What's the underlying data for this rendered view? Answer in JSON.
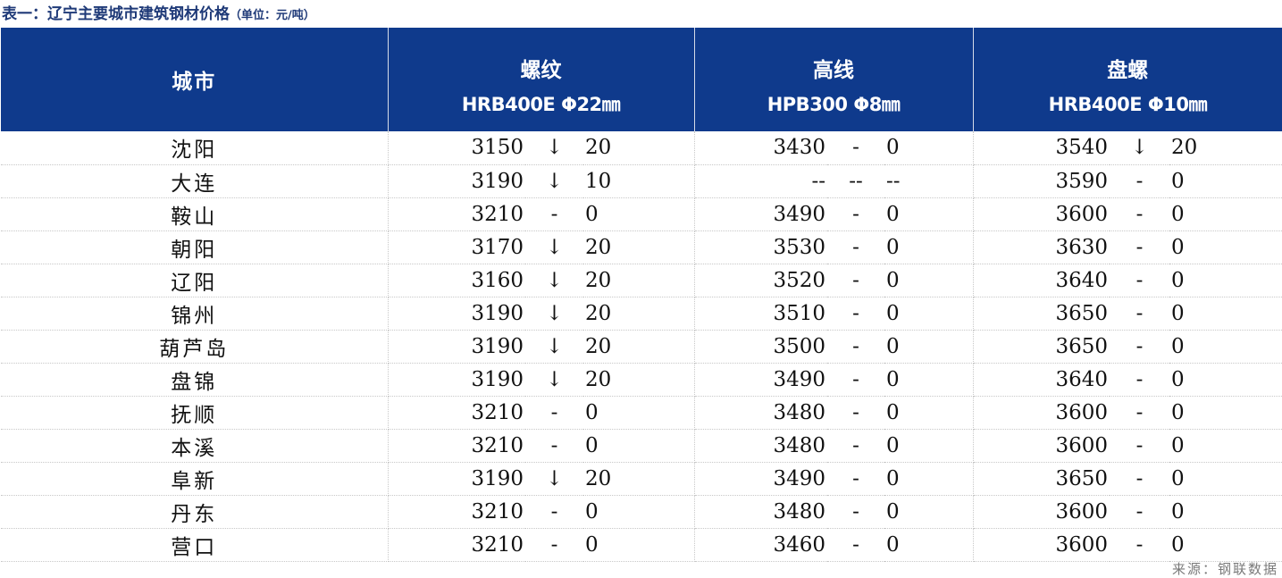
{
  "caption": {
    "title": "表一：辽宁主要城市建筑钢材价格",
    "unit": "（单位：元/吨）"
  },
  "header": {
    "city": "城市",
    "groups": [
      {
        "name": "螺纹",
        "spec": "HRB400E Φ22㎜"
      },
      {
        "name": "高线",
        "spec": "HPB300 Φ8㎜"
      },
      {
        "name": "盘螺",
        "spec": "HRB400E Φ10㎜"
      }
    ]
  },
  "colors": {
    "header_bg": "#0f3a8c",
    "header_text": "#ffffff",
    "caption_text": "#1f3a78",
    "decrease": "#1aa24a"
  },
  "icons": {
    "decrease": "down-arrow-icon",
    "flat": "dash"
  },
  "rows": [
    {
      "city": "沈阳",
      "rebar": {
        "price": "3150",
        "chg": "↓",
        "diff": "20"
      },
      "wire": {
        "price": "3430",
        "chg": "-",
        "diff": "0"
      },
      "coil": {
        "price": "3540",
        "chg": "↓",
        "diff": "20"
      }
    },
    {
      "city": "大连",
      "rebar": {
        "price": "3190",
        "chg": "↓",
        "diff": "10"
      },
      "wire": {
        "price": "--",
        "chg": "--",
        "diff": "--"
      },
      "coil": {
        "price": "3590",
        "chg": "-",
        "diff": "0"
      }
    },
    {
      "city": "鞍山",
      "rebar": {
        "price": "3210",
        "chg": "-",
        "diff": "0"
      },
      "wire": {
        "price": "3490",
        "chg": "-",
        "diff": "0"
      },
      "coil": {
        "price": "3600",
        "chg": "-",
        "diff": "0"
      }
    },
    {
      "city": "朝阳",
      "rebar": {
        "price": "3170",
        "chg": "↓",
        "diff": "20"
      },
      "wire": {
        "price": "3530",
        "chg": "-",
        "diff": "0"
      },
      "coil": {
        "price": "3630",
        "chg": "-",
        "diff": "0"
      }
    },
    {
      "city": "辽阳",
      "rebar": {
        "price": "3160",
        "chg": "↓",
        "diff": "20"
      },
      "wire": {
        "price": "3520",
        "chg": "-",
        "diff": "0"
      },
      "coil": {
        "price": "3640",
        "chg": "-",
        "diff": "0"
      }
    },
    {
      "city": "锦州",
      "rebar": {
        "price": "3190",
        "chg": "↓",
        "diff": "20"
      },
      "wire": {
        "price": "3510",
        "chg": "-",
        "diff": "0"
      },
      "coil": {
        "price": "3650",
        "chg": "-",
        "diff": "0"
      }
    },
    {
      "city": "葫芦岛",
      "rebar": {
        "price": "3190",
        "chg": "↓",
        "diff": "20"
      },
      "wire": {
        "price": "3500",
        "chg": "-",
        "diff": "0"
      },
      "coil": {
        "price": "3650",
        "chg": "-",
        "diff": "0"
      }
    },
    {
      "city": "盘锦",
      "rebar": {
        "price": "3190",
        "chg": "↓",
        "diff": "20"
      },
      "wire": {
        "price": "3490",
        "chg": "-",
        "diff": "0"
      },
      "coil": {
        "price": "3640",
        "chg": "-",
        "diff": "0"
      }
    },
    {
      "city": "抚顺",
      "rebar": {
        "price": "3210",
        "chg": "-",
        "diff": "0"
      },
      "wire": {
        "price": "3480",
        "chg": "-",
        "diff": "0"
      },
      "coil": {
        "price": "3600",
        "chg": "-",
        "diff": "0"
      }
    },
    {
      "city": "本溪",
      "rebar": {
        "price": "3210",
        "chg": "-",
        "diff": "0"
      },
      "wire": {
        "price": "3480",
        "chg": "-",
        "diff": "0"
      },
      "coil": {
        "price": "3600",
        "chg": "-",
        "diff": "0"
      }
    },
    {
      "city": "阜新",
      "rebar": {
        "price": "3190",
        "chg": "↓",
        "diff": "20"
      },
      "wire": {
        "price": "3490",
        "chg": "-",
        "diff": "0"
      },
      "coil": {
        "price": "3650",
        "chg": "-",
        "diff": "0"
      }
    },
    {
      "city": "丹东",
      "rebar": {
        "price": "3210",
        "chg": "-",
        "diff": "0"
      },
      "wire": {
        "price": "3480",
        "chg": "-",
        "diff": "0"
      },
      "coil": {
        "price": "3600",
        "chg": "-",
        "diff": "0"
      }
    },
    {
      "city": "营口",
      "rebar": {
        "price": "3210",
        "chg": "-",
        "diff": "0"
      },
      "wire": {
        "price": "3460",
        "chg": "-",
        "diff": "0"
      },
      "coil": {
        "price": "3600",
        "chg": "-",
        "diff": "0"
      }
    }
  ],
  "footer": {
    "source": "来源：钢联数据"
  }
}
